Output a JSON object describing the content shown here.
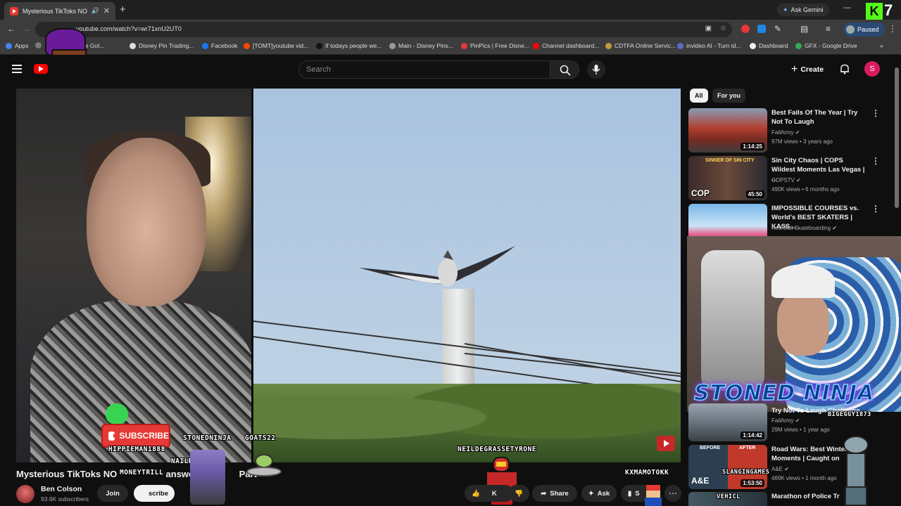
{
  "browser": {
    "tab_title": "Mysterious TikToks NO ON",
    "url": "youtube.com/watch?v=wr71xnU2UT0",
    "ask_gemini": "Ask Gemini",
    "profile_status": "Paused",
    "bookmarks": [
      {
        "label": "Apps",
        "color": "#4285f4"
      },
      {
        "label": "",
        "color": "#777777"
      },
      {
        "label": "ensive Gol...",
        "color": "#8e24aa"
      },
      {
        "label": "Disney Pin Trading...",
        "color": "#dddddd"
      },
      {
        "label": "Facebook",
        "color": "#1877f2"
      },
      {
        "label": "[TOMT]youtube vid...",
        "color": "#ff4500"
      },
      {
        "label": "If todays people we...",
        "color": "#111111"
      },
      {
        "label": "Main - Disney Pins...",
        "color": "#999999"
      },
      {
        "label": "PinPics | Free Disne...",
        "color": "#e53935"
      },
      {
        "label": "Channel dashboard...",
        "color": "#ff0000"
      },
      {
        "label": "CDTFA Online Servic...",
        "color": "#c49a3a"
      },
      {
        "label": "invideo AI - Turn id...",
        "color": "#5c6bc0"
      },
      {
        "label": "Dashboard",
        "color": "#eeeeee"
      },
      {
        "label": "GFX - Google Drive",
        "color": "#34a853"
      }
    ]
  },
  "header": {
    "search_placeholder": "Search",
    "create_label": "Create",
    "avatar_letter": "S"
  },
  "video": {
    "title_parts": [
      "Mysterious TikToks NO",
      "answer",
      "Part"
    ],
    "channel_name": "Ben Colson",
    "subscribers": "93.6K subscribers",
    "join_label": "Join",
    "subscribe_partial": "scribe",
    "like_count": "K",
    "share_label": "Share",
    "ask_label": "Ask",
    "save_partial": "S",
    "overlay_names": [
      "STONEDNINJA",
      "GOATS22",
      "HIPPIEMAN1888",
      "NAILBEATER",
      "MONEYTRILL",
      "NEILDEGRASSETYRONE",
      "KXMAMOTOKK",
      "SLANGINGAMES",
      "VEHICL",
      "BIGEGGY1873"
    ],
    "subscribe_overlay": "SUBSCRIBE"
  },
  "sidebar": {
    "chips": [
      "All",
      "For you"
    ],
    "recommendations": [
      {
        "title": "Best Fails Of The Year | Try Not To Laugh",
        "channel": "FailArmy",
        "meta": "97M views • 3 years ago",
        "duration": "1:14:25"
      },
      {
        "title": "Sin City Chaos | COPS Wildest Moments Las Vegas | ...",
        "channel": "COPSTV",
        "meta": "490K views • 6 months ago",
        "duration": "45:50"
      },
      {
        "title": "IMPOSSIBLE COURSES vs. World's BEST SKATERS | KASS...",
        "channel": "Red Bull Skateboarding",
        "meta": "",
        "duration": ""
      },
      {
        "title": "Try Not To Laugh Challenge",
        "channel": "FailArmy",
        "meta": "29M views • 1 year ago",
        "duration": "1:14:42"
      },
      {
        "title": "Road Wars: Best Winter Moments | Caught on",
        "channel": "A&E",
        "meta": "469K views • 1 month ago",
        "duration": "1:53:50"
      },
      {
        "title": "Marathon of Police Tr",
        "channel": "",
        "meta": "",
        "duration": ""
      }
    ],
    "thumb_texts": [
      "SINNER OF SIN CITY",
      "COP",
      "BEFORE",
      "AFTER",
      "A&E"
    ],
    "stoned_ninja_overlay": "STONED NINJA"
  },
  "colors": {
    "youtube_red": "#ff0000",
    "page_bg": "#0f0f0f",
    "accent_blue": "#3ea6ff"
  }
}
